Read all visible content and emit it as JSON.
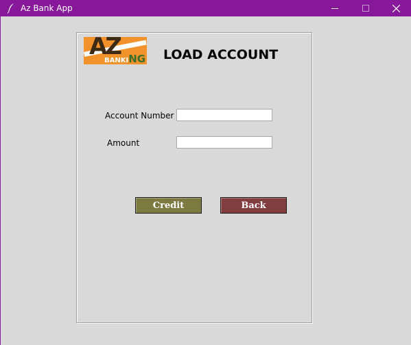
{
  "window": {
    "title": "Az Bank App",
    "icon": "feather-icon",
    "controls": {
      "minimize": "—",
      "maximize": "☐",
      "close": "✕"
    },
    "titlebar_color": "#88189a"
  },
  "logo": {
    "brand": "AZ",
    "word": "BANKI",
    "word_tail": "NG",
    "background_color": "#f2922a"
  },
  "form": {
    "heading": "LOAD ACCOUNT",
    "account_number_label": "Account Number",
    "account_number_value": "",
    "amount_label": "Amount",
    "amount_value": ""
  },
  "buttons": {
    "credit_label": "Credit",
    "credit_color": "#7c7a40",
    "back_label": "Back",
    "back_color": "#823e3e"
  }
}
